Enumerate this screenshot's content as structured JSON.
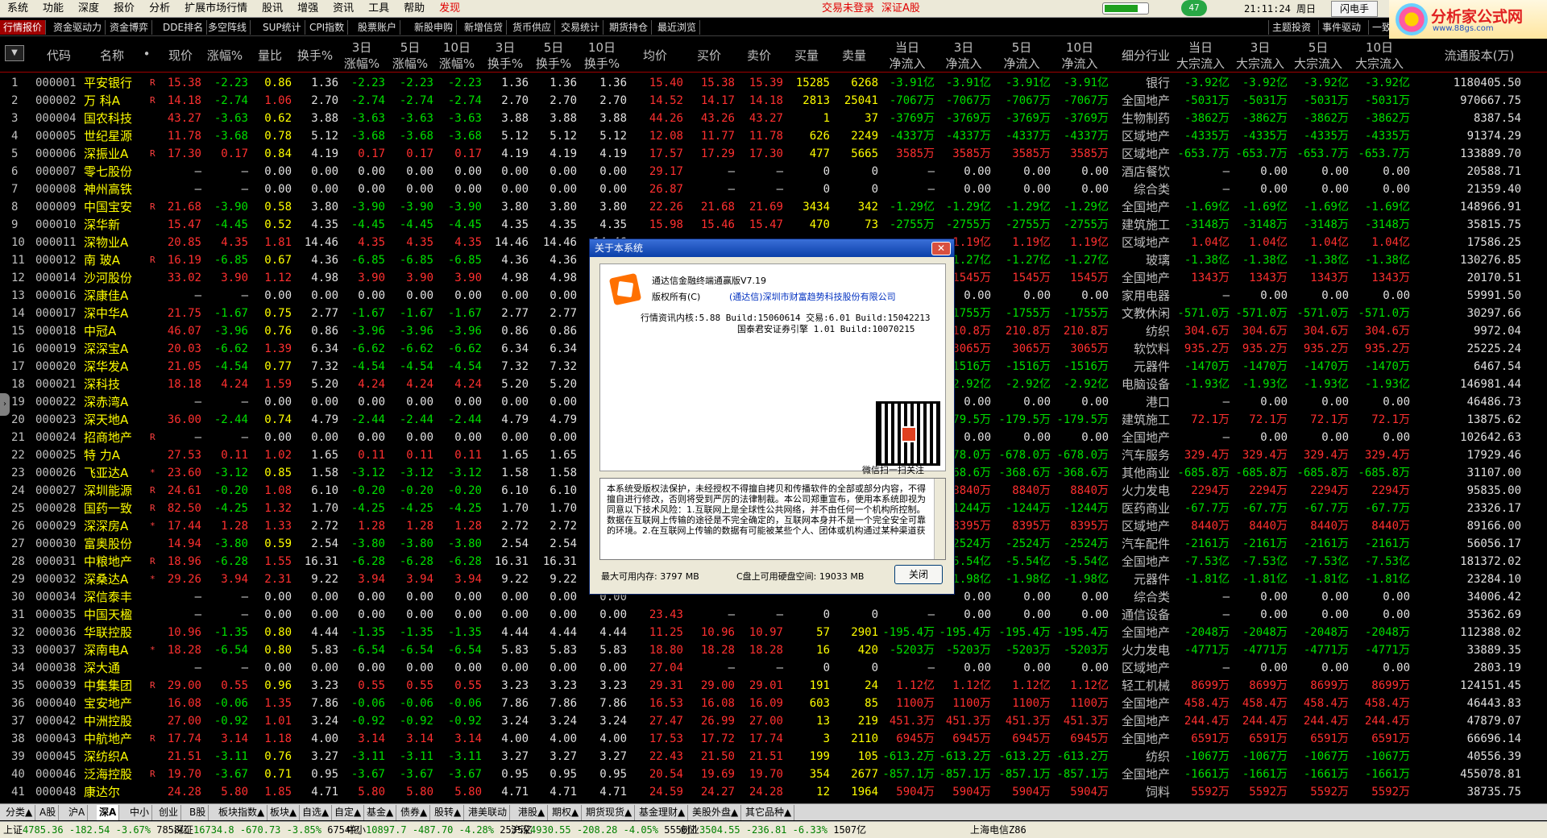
{
  "menu": {
    "items": [
      "系统",
      "功能",
      "深度",
      "报价",
      "分析",
      "扩展市场行情",
      "股讯",
      "增强",
      "资讯",
      "工具",
      "帮助"
    ],
    "discover": "发现",
    "login_status": "交易未登录",
    "market": "深证A股",
    "counter": "47",
    "progress": 0.75,
    "clock": "21:11:24 周日",
    "flash_button": "闪电手",
    "logo_text": "分析家公式网",
    "logo_domain": "www.88gs.com"
  },
  "toolbar": {
    "tabs": [
      "行情报价",
      "资金驱动力",
      "资金博弈",
      "DDE排名",
      "多空阵线",
      "SUP统计",
      "CPI指数",
      "股票账户",
      "新股申购",
      "新增信贷",
      "货币供应",
      "交易统计",
      "期货持仓",
      "最近浏览"
    ],
    "right_tabs": [
      "主题投资",
      "事件驱动",
      "一致预期",
      "板块轮"
    ]
  },
  "header": {
    "code": "代码",
    "name": "名称",
    "dot": "•",
    "price": "现价",
    "change": "涨幅%",
    "vol_ratio": "量比",
    "turnover": "换手%",
    "d3": "3日",
    "d5": "5日",
    "d10": "10日",
    "rise": "涨幅%",
    "turn": "换手%",
    "avg": "均价",
    "bid": "买价",
    "ask": "卖价",
    "buy_vol": "买量",
    "sell_vol": "卖量",
    "today": "当日",
    "net_inflow": "净流入",
    "industry": "细分行业",
    "bulk_inflow": "大宗流入",
    "float_shares": "流通股本(万)"
  },
  "rows": [
    [
      "1",
      "000001",
      "平安银行",
      "R",
      "15.38",
      "-2.23",
      "0.86",
      "1.36",
      "-2.23",
      "-2.23",
      "-2.23",
      "1.36",
      "1.36",
      "1.36",
      "15.40",
      "15.38",
      "15.39",
      "15285",
      "6268",
      "-3.91亿",
      "-3.91亿",
      "-3.91亿",
      "-3.91亿",
      "银行",
      "-3.92亿",
      "-3.92亿",
      "-3.92亿",
      "-3.92亿",
      "1180405.50"
    ],
    [
      "2",
      "000002",
      "万 科A",
      "R",
      "14.18",
      "-2.74",
      "1.06",
      "2.70",
      "-2.74",
      "-2.74",
      "-2.74",
      "2.70",
      "2.70",
      "2.70",
      "14.52",
      "14.17",
      "14.18",
      "2813",
      "25041",
      "-7067万",
      "-7067万",
      "-7067万",
      "-7067万",
      "全国地产",
      "-5031万",
      "-5031万",
      "-5031万",
      "-5031万",
      "970667.75"
    ],
    [
      "3",
      "000004",
      "国农科技",
      "",
      "43.27",
      "-3.63",
      "0.62",
      "3.88",
      "-3.63",
      "-3.63",
      "-3.63",
      "3.88",
      "3.88",
      "3.88",
      "44.26",
      "43.26",
      "43.27",
      "1",
      "37",
      "-3769万",
      "-3769万",
      "-3769万",
      "-3769万",
      "生物制药",
      "-3862万",
      "-3862万",
      "-3862万",
      "-3862万",
      "8387.54"
    ],
    [
      "4",
      "000005",
      "世纪星源",
      "",
      "11.78",
      "-3.68",
      "0.78",
      "5.12",
      "-3.68",
      "-3.68",
      "-3.68",
      "5.12",
      "5.12",
      "5.12",
      "12.08",
      "11.77",
      "11.78",
      "626",
      "2249",
      "-4337万",
      "-4337万",
      "-4337万",
      "-4337万",
      "区域地产",
      "-4335万",
      "-4335万",
      "-4335万",
      "-4335万",
      "91374.29"
    ],
    [
      "5",
      "000006",
      "深振业A",
      "R",
      "17.30",
      "0.17",
      "0.84",
      "4.19",
      "0.17",
      "0.17",
      "0.17",
      "4.19",
      "4.19",
      "4.19",
      "17.57",
      "17.29",
      "17.30",
      "477",
      "5665",
      "3585万",
      "3585万",
      "3585万",
      "3585万",
      "区域地产",
      "-653.7万",
      "-653.7万",
      "-653.7万",
      "-653.7万",
      "133889.70"
    ],
    [
      "6",
      "000007",
      "零七股份",
      "",
      "—",
      "—",
      "0.00",
      "0.00",
      "0.00",
      "0.00",
      "0.00",
      "0.00",
      "0.00",
      "0.00",
      "29.17",
      "—",
      "—",
      "0",
      "0",
      "—",
      "0.00",
      "0.00",
      "0.00",
      "酒店餐饮",
      "—",
      "0.00",
      "0.00",
      "0.00",
      "20588.71"
    ],
    [
      "7",
      "000008",
      "神州高铁",
      "",
      "—",
      "—",
      "0.00",
      "0.00",
      "0.00",
      "0.00",
      "0.00",
      "0.00",
      "0.00",
      "0.00",
      "26.87",
      "—",
      "—",
      "0",
      "0",
      "—",
      "0.00",
      "0.00",
      "0.00",
      "综合类",
      "—",
      "0.00",
      "0.00",
      "0.00",
      "21359.40"
    ],
    [
      "8",
      "000009",
      "中国宝安",
      "R",
      "21.68",
      "-3.90",
      "0.58",
      "3.80",
      "-3.90",
      "-3.90",
      "-3.90",
      "3.80",
      "3.80",
      "3.80",
      "22.26",
      "21.68",
      "21.69",
      "3434",
      "342",
      "-1.29亿",
      "-1.29亿",
      "-1.29亿",
      "-1.29亿",
      "全国地产",
      "-1.69亿",
      "-1.69亿",
      "-1.69亿",
      "-1.69亿",
      "148966.91"
    ],
    [
      "9",
      "000010",
      "深华新",
      "",
      "15.47",
      "-4.45",
      "0.52",
      "4.35",
      "-4.45",
      "-4.45",
      "-4.45",
      "4.35",
      "4.35",
      "4.35",
      "15.98",
      "15.46",
      "15.47",
      "470",
      "73",
      "-2755万",
      "-2755万",
      "-2755万",
      "-2755万",
      "建筑施工",
      "-3148万",
      "-3148万",
      "-3148万",
      "-3148万",
      "35815.75"
    ],
    [
      "10",
      "000011",
      "深物业A",
      "",
      "20.85",
      "4.35",
      "1.81",
      "14.46",
      "4.35",
      "4.35",
      "4.35",
      "14.46",
      "14.46",
      "14.46",
      "",
      "",
      "",
      "",
      "",
      "",
      "1.19亿",
      "1.19亿",
      "1.19亿",
      "区域地产",
      "1.04亿",
      "1.04亿",
      "1.04亿",
      "1.04亿",
      "17586.25"
    ],
    [
      "11",
      "000012",
      "南 玻A",
      "R",
      "16.19",
      "-6.85",
      "0.67",
      "4.36",
      "-6.85",
      "-6.85",
      "-6.85",
      "4.36",
      "4.36",
      "",
      "",
      "",
      "",
      "",
      "",
      "",
      "-1.27亿",
      "-1.27亿",
      "-1.27亿",
      "玻璃",
      "-1.38亿",
      "-1.38亿",
      "-1.38亿",
      "-1.38亿",
      "130276.85"
    ],
    [
      "12",
      "000014",
      "沙河股份",
      "",
      "33.02",
      "3.90",
      "1.12",
      "4.98",
      "3.90",
      "3.90",
      "3.90",
      "4.98",
      "4.98",
      "",
      "",
      "",
      "",
      "",
      "",
      "",
      "1545万",
      "1545万",
      "1545万",
      "全国地产",
      "1343万",
      "1343万",
      "1343万",
      "1343万",
      "20170.51"
    ],
    [
      "13",
      "000016",
      "深康佳A",
      "",
      "—",
      "—",
      "0.00",
      "0.00",
      "0.00",
      "0.00",
      "0.00",
      "0.00",
      "0.00",
      "",
      "",
      "",
      "",
      "",
      "",
      "",
      "0.00",
      "0.00",
      "0.00",
      "家用电器",
      "—",
      "0.00",
      "0.00",
      "0.00",
      "59991.50"
    ],
    [
      "14",
      "000017",
      "深中华A",
      "",
      "21.75",
      "-1.67",
      "0.75",
      "2.77",
      "-1.67",
      "-1.67",
      "-1.67",
      "2.77",
      "2.77",
      "",
      "",
      "",
      "",
      "",
      "",
      "",
      "-1755万",
      "-1755万",
      "-1755万",
      "文教休闲",
      "-571.0万",
      "-571.0万",
      "-571.0万",
      "-571.0万",
      "30297.66"
    ],
    [
      "15",
      "000018",
      "中冠A",
      "",
      "46.07",
      "-3.96",
      "0.76",
      "0.86",
      "-3.96",
      "-3.96",
      "-3.96",
      "0.86",
      "0.86",
      "",
      "",
      "",
      "",
      "",
      "",
      "",
      "210.8万",
      "210.8万",
      "210.8万",
      "纺织",
      "304.6万",
      "304.6万",
      "304.6万",
      "304.6万",
      "9972.04"
    ],
    [
      "16",
      "000019",
      "深深宝A",
      "",
      "20.03",
      "-6.62",
      "1.39",
      "6.34",
      "-6.62",
      "-6.62",
      "-6.62",
      "6.34",
      "6.34",
      "",
      "",
      "",
      "",
      "",
      "",
      "",
      "3065万",
      "3065万",
      "3065万",
      "软饮料",
      "935.2万",
      "935.2万",
      "935.2万",
      "935.2万",
      "25225.24"
    ],
    [
      "17",
      "000020",
      "深华发A",
      "",
      "21.05",
      "-4.54",
      "0.77",
      "7.32",
      "-4.54",
      "-4.54",
      "-4.54",
      "7.32",
      "7.32",
      "",
      "",
      "",
      "",
      "",
      "",
      "",
      "-1516万",
      "-1516万",
      "-1516万",
      "元器件",
      "-1470万",
      "-1470万",
      "-1470万",
      "-1470万",
      "6467.54"
    ],
    [
      "18",
      "000021",
      "深科技",
      "",
      "18.18",
      "4.24",
      "1.59",
      "5.20",
      "4.24",
      "4.24",
      "4.24",
      "5.20",
      "5.20",
      "",
      "",
      "",
      "",
      "",
      "",
      "",
      "-2.92亿",
      "-2.92亿",
      "-2.92亿",
      "电脑设备",
      "-1.93亿",
      "-1.93亿",
      "-1.93亿",
      "-1.93亿",
      "146981.44"
    ],
    [
      "19",
      "000022",
      "深赤湾A",
      "",
      "—",
      "—",
      "0.00",
      "0.00",
      "0.00",
      "0.00",
      "0.00",
      "0.00",
      "0.00",
      "",
      "",
      "",
      "",
      "",
      "",
      "",
      "0.00",
      "0.00",
      "0.00",
      "港口",
      "—",
      "0.00",
      "0.00",
      "0.00",
      "46486.73"
    ],
    [
      "20",
      "000023",
      "深天地A",
      "",
      "36.00",
      "-2.44",
      "0.74",
      "4.79",
      "-2.44",
      "-2.44",
      "-2.44",
      "4.79",
      "4.79",
      "",
      "",
      "",
      "",
      "",
      "",
      "",
      "-179.5万",
      "-179.5万",
      "-179.5万",
      "建筑施工",
      "72.1万",
      "72.1万",
      "72.1万",
      "72.1万",
      "13875.62"
    ],
    [
      "21",
      "000024",
      "招商地产",
      "R",
      "—",
      "—",
      "0.00",
      "0.00",
      "0.00",
      "0.00",
      "0.00",
      "0.00",
      "0.00",
      "",
      "",
      "",
      "",
      "",
      "",
      "",
      "0.00",
      "0.00",
      "0.00",
      "全国地产",
      "—",
      "0.00",
      "0.00",
      "0.00",
      "102642.63"
    ],
    [
      "22",
      "000025",
      "特 力A",
      "",
      "27.53",
      "0.11",
      "1.02",
      "1.65",
      "0.11",
      "0.11",
      "0.11",
      "1.65",
      "1.65",
      "",
      "",
      "",
      "",
      "",
      "",
      "",
      "-678.0万",
      "-678.0万",
      "-678.0万",
      "汽车服务",
      "329.4万",
      "329.4万",
      "329.4万",
      "329.4万",
      "17929.46"
    ],
    [
      "23",
      "000026",
      "飞亚达A",
      "*",
      "23.60",
      "-3.12",
      "0.85",
      "1.58",
      "-3.12",
      "-3.12",
      "-3.12",
      "1.58",
      "1.58",
      "",
      "",
      "",
      "",
      "",
      "",
      "",
      "-368.6万",
      "-368.6万",
      "-368.6万",
      "其他商业",
      "-685.8万",
      "-685.8万",
      "-685.8万",
      "-685.8万",
      "31107.00"
    ],
    [
      "24",
      "000027",
      "深圳能源",
      "R",
      "24.61",
      "-0.20",
      "1.08",
      "6.10",
      "-0.20",
      "-0.20",
      "-0.20",
      "6.10",
      "6.10",
      "",
      "",
      "",
      "",
      "",
      "",
      "",
      "8840万",
      "8840万",
      "8840万",
      "火力发电",
      "2294万",
      "2294万",
      "2294万",
      "2294万",
      "95835.00"
    ],
    [
      "25",
      "000028",
      "国药一致",
      "R",
      "82.50",
      "-4.25",
      "1.32",
      "1.70",
      "-4.25",
      "-4.25",
      "-4.25",
      "1.70",
      "1.70",
      "",
      "",
      "",
      "",
      "",
      "",
      "",
      "-1244万",
      "-1244万",
      "-1244万",
      "医药商业",
      "-67.7万",
      "-67.7万",
      "-67.7万",
      "-67.7万",
      "23326.17"
    ],
    [
      "26",
      "000029",
      "深深房A",
      "*",
      "17.44",
      "1.28",
      "1.33",
      "2.72",
      "1.28",
      "1.28",
      "1.28",
      "2.72",
      "2.72",
      "",
      "",
      "",
      "",
      "",
      "",
      "",
      "8395万",
      "8395万",
      "8395万",
      "区域地产",
      "8440万",
      "8440万",
      "8440万",
      "8440万",
      "89166.00"
    ],
    [
      "27",
      "000030",
      "富奥股份",
      "",
      "14.94",
      "-3.80",
      "0.59",
      "2.54",
      "-3.80",
      "-3.80",
      "-3.80",
      "2.54",
      "2.54",
      "",
      "",
      "",
      "",
      "",
      "",
      "",
      "-2524万",
      "-2524万",
      "-2524万",
      "汽车配件",
      "-2161万",
      "-2161万",
      "-2161万",
      "-2161万",
      "56056.17"
    ],
    [
      "28",
      "000031",
      "中粮地产",
      "R",
      "18.96",
      "-6.28",
      "1.55",
      "16.31",
      "-6.28",
      "-6.28",
      "-6.28",
      "16.31",
      "16.31",
      "",
      "",
      "",
      "",
      "",
      "",
      "",
      "-5.54亿",
      "-5.54亿",
      "-5.54亿",
      "全国地产",
      "-7.53亿",
      "-7.53亿",
      "-7.53亿",
      "-7.53亿",
      "181372.02"
    ],
    [
      "29",
      "000032",
      "深桑达A",
      "*",
      "29.26",
      "3.94",
      "2.31",
      "9.22",
      "3.94",
      "3.94",
      "3.94",
      "9.22",
      "9.22",
      "",
      "",
      "",
      "",
      "",
      "",
      "",
      "-1.98亿",
      "-1.98亿",
      "-1.98亿",
      "元器件",
      "-1.81亿",
      "-1.81亿",
      "-1.81亿",
      "-1.81亿",
      "23284.10"
    ],
    [
      "30",
      "000034",
      "深信泰丰",
      "",
      "—",
      "—",
      "0.00",
      "0.00",
      "0.00",
      "0.00",
      "0.00",
      "0.00",
      "0.00",
      "0.00",
      "",
      "",
      "",
      "",
      "",
      "",
      "0.00",
      "0.00",
      "0.00",
      "综合类",
      "—",
      "0.00",
      "0.00",
      "0.00",
      "34006.42"
    ],
    [
      "31",
      "000035",
      "中国天楹",
      "",
      "—",
      "—",
      "0.00",
      "0.00",
      "0.00",
      "0.00",
      "0.00",
      "0.00",
      "0.00",
      "0.00",
      "23.43",
      "—",
      "—",
      "0",
      "0",
      "—",
      "0.00",
      "0.00",
      "0.00",
      "通信设备",
      "—",
      "0.00",
      "0.00",
      "0.00",
      "35362.69"
    ],
    [
      "32",
      "000036",
      "华联控股",
      "",
      "10.96",
      "-1.35",
      "0.80",
      "4.44",
      "-1.35",
      "-1.35",
      "-1.35",
      "4.44",
      "4.44",
      "4.44",
      "11.25",
      "10.96",
      "10.97",
      "57",
      "2901",
      "-195.4万",
      "-195.4万",
      "-195.4万",
      "-195.4万",
      "全国地产",
      "-2048万",
      "-2048万",
      "-2048万",
      "-2048万",
      "112388.02"
    ],
    [
      "33",
      "000037",
      "深南电A",
      "*",
      "18.28",
      "-6.54",
      "0.80",
      "5.83",
      "-6.54",
      "-6.54",
      "-6.54",
      "5.83",
      "5.83",
      "5.83",
      "18.80",
      "18.28",
      "18.28",
      "16",
      "420",
      "-5203万",
      "-5203万",
      "-5203万",
      "-5203万",
      "火力发电",
      "-4771万",
      "-4771万",
      "-4771万",
      "-4771万",
      "33889.35"
    ],
    [
      "34",
      "000038",
      "深大通",
      "",
      "—",
      "—",
      "0.00",
      "0.00",
      "0.00",
      "0.00",
      "0.00",
      "0.00",
      "0.00",
      "0.00",
      "27.04",
      "—",
      "—",
      "0",
      "0",
      "—",
      "0.00",
      "0.00",
      "0.00",
      "区域地产",
      "—",
      "0.00",
      "0.00",
      "0.00",
      "2803.19"
    ],
    [
      "35",
      "000039",
      "中集集团",
      "R",
      "29.00",
      "0.55",
      "0.96",
      "3.23",
      "0.55",
      "0.55",
      "0.55",
      "3.23",
      "3.23",
      "3.23",
      "29.31",
      "29.00",
      "29.01",
      "191",
      "24",
      "1.12亿",
      "1.12亿",
      "1.12亿",
      "1.12亿",
      "轻工机械",
      "8699万",
      "8699万",
      "8699万",
      "8699万",
      "124151.45"
    ],
    [
      "36",
      "000040",
      "宝安地产",
      "",
      "16.08",
      "-0.06",
      "1.35",
      "7.86",
      "-0.06",
      "-0.06",
      "-0.06",
      "7.86",
      "7.86",
      "7.86",
      "16.53",
      "16.08",
      "16.09",
      "603",
      "85",
      "1100万",
      "1100万",
      "1100万",
      "1100万",
      "全国地产",
      "458.4万",
      "458.4万",
      "458.4万",
      "458.4万",
      "46443.83"
    ],
    [
      "37",
      "000042",
      "中洲控股",
      "",
      "27.00",
      "-0.92",
      "1.01",
      "3.24",
      "-0.92",
      "-0.92",
      "-0.92",
      "3.24",
      "3.24",
      "3.24",
      "27.47",
      "26.99",
      "27.00",
      "13",
      "219",
      "451.3万",
      "451.3万",
      "451.3万",
      "451.3万",
      "全国地产",
      "244.4万",
      "244.4万",
      "244.4万",
      "244.4万",
      "47879.07"
    ],
    [
      "38",
      "000043",
      "中航地产",
      "R",
      "17.74",
      "3.14",
      "1.18",
      "4.00",
      "3.14",
      "3.14",
      "3.14",
      "4.00",
      "4.00",
      "4.00",
      "17.53",
      "17.72",
      "17.74",
      "3",
      "2110",
      "6945万",
      "6945万",
      "6945万",
      "6945万",
      "全国地产",
      "6591万",
      "6591万",
      "6591万",
      "6591万",
      "66696.14"
    ],
    [
      "39",
      "000045",
      "深纺织A",
      "",
      "21.51",
      "-3.11",
      "0.76",
      "3.27",
      "-3.11",
      "-3.11",
      "-3.11",
      "3.27",
      "3.27",
      "3.27",
      "22.43",
      "21.50",
      "21.51",
      "199",
      "105",
      "-613.2万",
      "-613.2万",
      "-613.2万",
      "-613.2万",
      "纺织",
      "-1067万",
      "-1067万",
      "-1067万",
      "-1067万",
      "40556.39"
    ],
    [
      "40",
      "000046",
      "泛海控股",
      "R",
      "19.70",
      "-3.67",
      "0.71",
      "0.95",
      "-3.67",
      "-3.67",
      "-3.67",
      "0.95",
      "0.95",
      "0.95",
      "20.54",
      "19.69",
      "19.70",
      "354",
      "2677",
      "-857.1万",
      "-857.1万",
      "-857.1万",
      "-857.1万",
      "全国地产",
      "-1661万",
      "-1661万",
      "-1661万",
      "-1661万",
      "455078.81"
    ],
    [
      "41",
      "000048",
      "康达尔",
      "",
      "24.28",
      "5.80",
      "1.85",
      "4.71",
      "5.80",
      "5.80",
      "5.80",
      "4.71",
      "4.71",
      "4.71",
      "24.59",
      "24.27",
      "24.28",
      "12",
      "1964",
      "5904万",
      "5904万",
      "5904万",
      "5904万",
      "饲料",
      "5592万",
      "5592万",
      "5592万",
      "5592万",
      "38735.75"
    ]
  ],
  "bottom_tabs": [
    "分类▲",
    "A股",
    "沪A",
    "深A",
    "中小",
    "创业",
    "B股",
    "板块指数▲",
    "板块▲",
    "自选▲",
    "自定▲",
    "基金▲",
    "债券▲",
    "股转▲",
    "港美联动",
    "港股▲",
    "期权▲",
    "期货现货▲",
    "基金理财▲",
    "美股外盘▲",
    "其它品种▲"
  ],
  "status": {
    "items": [
      {
        "name": "上证",
        "value": "4785.36",
        "change": "-182.54",
        "pct": "-3.67%",
        "amount": "7858亿"
      },
      {
        "name": "深证",
        "value": "16734.8",
        "change": "-670.73",
        "pct": "-3.85%",
        "amount": "6754亿"
      },
      {
        "name": "中小",
        "value": "10897.7",
        "change": "-487.70",
        "pct": "-4.28%",
        "amount": "2535亿"
      },
      {
        "name": "沪深",
        "value": "4930.55",
        "change": "-208.28",
        "pct": "-4.05%",
        "amount": "5556亿"
      },
      {
        "name": "创业",
        "value": "3504.55",
        "change": "-236.81",
        "pct": "-6.33%",
        "amount": "1507亿"
      }
    ],
    "server": "上海电信Z86"
  },
  "dialog": {
    "title": "关于本系统",
    "product": "通达信金融终端通赢版V7.19",
    "copyright_label": "版权所有(C)",
    "copyright_holder": "(通达信)深圳市财富趋势科技股份有限公司",
    "kernel": "行情资讯内核:5.88 Build:15060614 交易:6.01 Build:15042213",
    "engine": "国泰君安证券引擎 1.01 Build:10070215",
    "qr_caption": "微信扫一扫关注",
    "license": "本系统受版权法保护，未经授权不得擅自拷贝和传播软件的全部或部分内容，不得擅自进行修改，否则将受到严厉的法律制裁。本公司郑重宣布，使用本系统即视为同意以下技术风险：1.互联网上是全球性公共网络，并不由任何一个机构所控制。数据在互联网上传输的途径是不完全确定的，互联网本身并不是一个完全安全可靠的环境。2.在互联网上传输的数据有可能被某些个人、团体或机构通过某种渠道获",
    "mem_label": "最大可用内存:",
    "mem_value": "3797 MB",
    "disk_label": "C盘上可用硬盘空间:",
    "disk_value": "19033 MB",
    "close_button": "关闭",
    "close_x": "✕"
  }
}
